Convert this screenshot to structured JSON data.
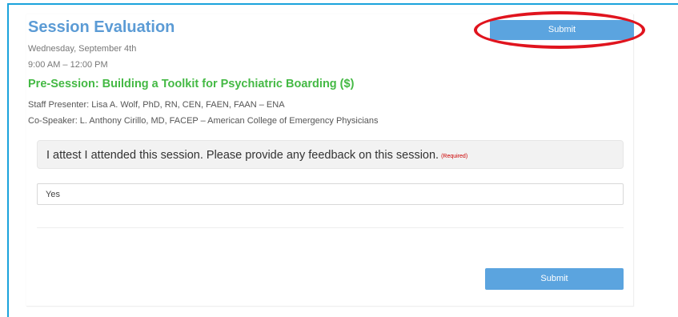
{
  "header": {
    "title": "Session Evaluation",
    "date": "Wednesday, September 4th",
    "time": "9:00 AM – 12:00 PM"
  },
  "session": {
    "title": "Pre-Session: Building a Toolkit for Psychiatric Boarding ($)",
    "presenter": "Staff Presenter: Lisa A. Wolf, PhD, RN, CEN, FAEN, FAAN – ENA",
    "cospeaker": "Co-Speaker: L. Anthony Cirillo, MD, FACEP – American College of Emergency Physicians"
  },
  "question": {
    "text": "I attest I attended this session. Please provide any feedback on this session.",
    "required_label": "(Required)"
  },
  "answer": {
    "value": "Yes"
  },
  "actions": {
    "submit_top_label": "Submit",
    "submit_bottom_label": "Submit"
  },
  "colors": {
    "frame_border": "#1ba3dc",
    "title": "#5b9bd5",
    "session_title": "#44b944",
    "button": "#5ba4df",
    "highlight": "#e0141e",
    "required": "#cc0000"
  }
}
